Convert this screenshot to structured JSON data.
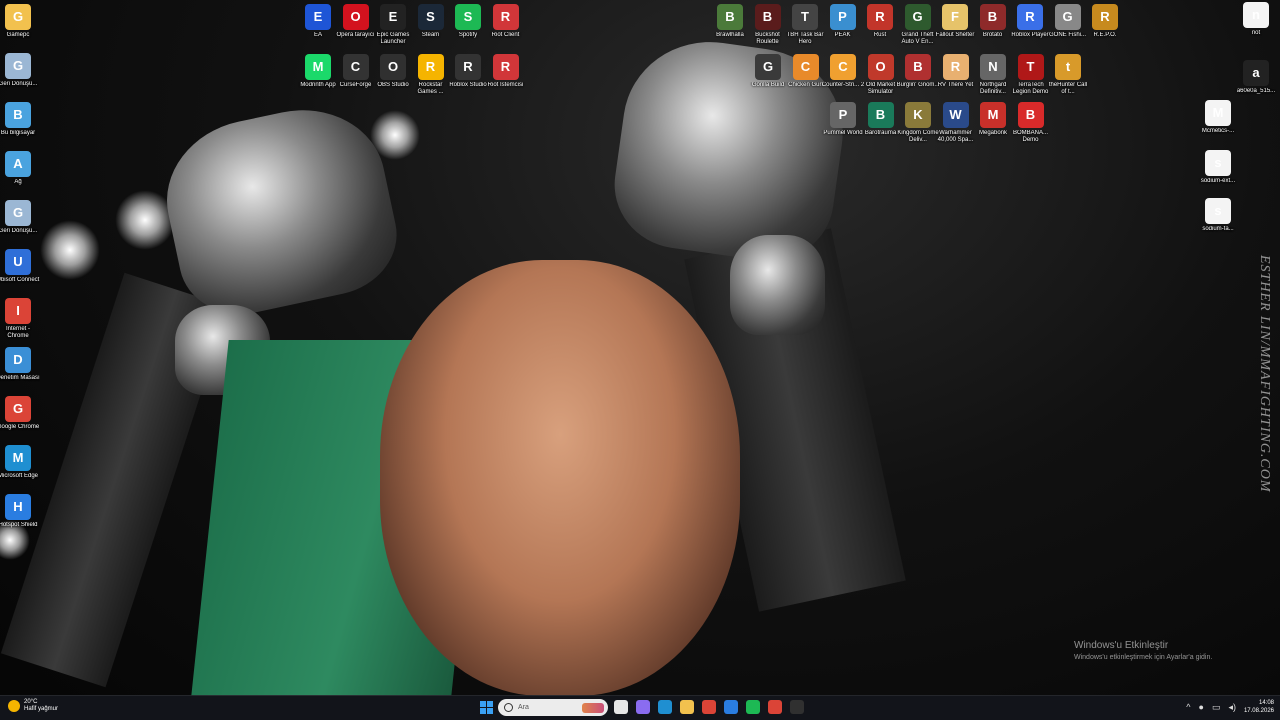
{
  "wallpaper": {
    "caption": "ESTHER LIN/MMAFIGHTING.COM"
  },
  "desktop": {
    "left_icons": [
      {
        "label": "Gamepc",
        "icon": "folder-icon",
        "color": "#f2c14e"
      },
      {
        "label": "Geri Dönüşü...",
        "icon": "recycle-bin-icon",
        "color": "#9bb7d4"
      },
      {
        "label": "Bu bilgisayar",
        "icon": "computer-icon",
        "color": "#4aa3df"
      },
      {
        "label": "Ağ",
        "icon": "network-icon",
        "color": "#4aa3df"
      },
      {
        "label": "Geri Dönüşü...",
        "icon": "recycle-bin-icon",
        "color": "#9bb7d4"
      },
      {
        "label": "Ubisoft Connect",
        "icon": "ubisoft-icon",
        "color": "#2f6fd8"
      },
      {
        "label": "Internet - Chrome",
        "icon": "chrome-icon",
        "color": "#db4437"
      },
      {
        "label": "Denetim Masası",
        "icon": "control-panel-icon",
        "color": "#3b8fd6"
      },
      {
        "label": "Google Chrome",
        "icon": "chrome-icon",
        "color": "#db4437"
      },
      {
        "label": "Microsoft Edge",
        "icon": "edge-icon",
        "color": "#1f8fd1"
      },
      {
        "label": "Hotspot Shield",
        "icon": "shield-icon",
        "color": "#2a7de1"
      }
    ],
    "top_icons_row1": [
      {
        "label": "EA",
        "icon": "ea-icon",
        "color": "#1e55d6"
      },
      {
        "label": "Opera tarayıcı",
        "icon": "opera-icon",
        "color": "#d3121e"
      },
      {
        "label": "Epic Games Launcher",
        "icon": "epic-games-icon",
        "color": "#222222"
      },
      {
        "label": "Steam",
        "icon": "steam-icon",
        "color": "#1b2838"
      },
      {
        "label": "Spotify",
        "icon": "spotify-icon",
        "color": "#1db954"
      },
      {
        "label": "Riot Client",
        "icon": "riot-icon",
        "color": "#d13639"
      }
    ],
    "top_icons_row2": [
      {
        "label": "Modrinth App",
        "icon": "modrinth-icon",
        "color": "#1bd96a"
      },
      {
        "label": "CurseForge",
        "icon": "curseforge-icon",
        "color": "#333333"
      },
      {
        "label": "OBS Studio",
        "icon": "obs-icon",
        "color": "#303030"
      },
      {
        "label": "Rockstar Games ...",
        "icon": "rockstar-icon",
        "color": "#f5b400"
      },
      {
        "label": "Roblox Studio",
        "icon": "roblox-studio-icon",
        "color": "#333333"
      },
      {
        "label": "Riot İstemcisi",
        "icon": "riot-icon",
        "color": "#d13639"
      }
    ],
    "right_icons_row1": [
      {
        "label": "Brawlhalla",
        "icon": "brawlhalla-icon",
        "color": "#4b7a3a"
      },
      {
        "label": "Buckshot Roulette",
        "icon": "buckshot-icon",
        "color": "#5a1c1c"
      },
      {
        "label": "TBH Task Bar Hero",
        "icon": "tbh-icon",
        "color": "#444444"
      },
      {
        "label": "PEAK",
        "icon": "peak-icon",
        "color": "#3a8fd0"
      },
      {
        "label": "Rust",
        "icon": "rust-icon",
        "color": "#c2352a"
      },
      {
        "label": "Grand Theft Auto V En...",
        "icon": "gta-icon",
        "color": "#2e5a2e"
      },
      {
        "label": "Fallout Shelter",
        "icon": "fallout-icon",
        "color": "#e6c36a"
      },
      {
        "label": "Brotato",
        "icon": "brotato-icon",
        "color": "#8e2a2a"
      },
      {
        "label": "Roblox Player",
        "icon": "roblox-icon",
        "color": "#3a6fe8"
      },
      {
        "label": "GONE Fishi...",
        "icon": "gone-fishing-icon",
        "color": "#888888"
      },
      {
        "label": "R.E.P.O.",
        "icon": "repo-icon",
        "color": "#c78a1e"
      }
    ],
    "right_icons_row2": [
      {
        "label": "Gorilla Build",
        "icon": "gorilla-icon",
        "color": "#3a3a3a"
      },
      {
        "label": "Chicken Gun",
        "icon": "chicken-icon",
        "color": "#e88a2a"
      },
      {
        "label": "Counter-Stri... 2",
        "icon": "cs2-icon",
        "color": "#f0a030"
      },
      {
        "label": "Old Market Simulator",
        "icon": "old-market-icon",
        "color": "#c0392b"
      },
      {
        "label": "Burglin' Gnom...",
        "icon": "gnome-icon",
        "color": "#b03030"
      },
      {
        "label": "RV There Yet",
        "icon": "rv-icon",
        "color": "#e8b070"
      },
      {
        "label": "Northgard Definitiv...",
        "icon": "northgard-icon",
        "color": "#666666"
      },
      {
        "label": "TerraTech Legion Demo",
        "icon": "terratech-icon",
        "color": "#b01818"
      },
      {
        "label": "theHunter Call of t...",
        "icon": "thehunter-icon",
        "color": "#d89a2a"
      }
    ],
    "right_icons_row3": [
      {
        "label": "Pummel World",
        "icon": "pummel-icon",
        "color": "#666666"
      },
      {
        "label": "Barotrauma",
        "icon": "barotrauma-icon",
        "color": "#1a7a5a"
      },
      {
        "label": "Kingdom Come Deliv...",
        "icon": "kingdom-come-icon",
        "color": "#8a7a3a"
      },
      {
        "label": "Warhammer 40,000 Spa...",
        "icon": "warhammer-icon",
        "color": "#2a4a8a"
      },
      {
        "label": "Megabonk",
        "icon": "megabonk-icon",
        "color": "#c8302a"
      },
      {
        "label": "BOMBANA... Demo",
        "icon": "bombana-icon",
        "color": "#d82a2a"
      }
    ],
    "far_right_icons": [
      {
        "label": "not",
        "icon": "text-file-icon",
        "color": "#f4f4f4"
      },
      {
        "label": "a60e0a_515...",
        "icon": "image-file-icon",
        "color": "#222222"
      },
      {
        "label": "Mcmetics-...",
        "icon": "text-file-icon",
        "color": "#f4f4f4"
      },
      {
        "label": "sodium-ext...",
        "icon": "text-file-icon",
        "color": "#f4f4f4"
      },
      {
        "label": "sodium-fa...",
        "icon": "text-file-icon",
        "color": "#f4f4f4"
      }
    ]
  },
  "activation": {
    "title": "Windows'u Etkinleştir",
    "subtitle": "Windows'u etkinleştirmek için Ayarlar'a gidin."
  },
  "taskbar": {
    "weather": {
      "temp": "20°C",
      "desc": "Hafif yağmur"
    },
    "search_placeholder": "Ara",
    "apps": [
      {
        "icon": "task-view-icon",
        "color": "#e6e6e6"
      },
      {
        "icon": "copilot-icon",
        "color": "#8a6cf0"
      },
      {
        "icon": "edge-icon",
        "color": "#1f8fd1"
      },
      {
        "icon": "file-explorer-icon",
        "color": "#f2c14e"
      },
      {
        "icon": "chrome-icon",
        "color": "#db4437"
      },
      {
        "icon": "mail-icon",
        "color": "#2a7de1"
      },
      {
        "icon": "spotify-icon",
        "color": "#1db954"
      },
      {
        "icon": "chrome-alt-icon",
        "color": "#db4437"
      },
      {
        "icon": "obs-icon",
        "color": "#303030"
      }
    ],
    "clock": {
      "time": "14:08",
      "date": "17.08.2026"
    }
  }
}
